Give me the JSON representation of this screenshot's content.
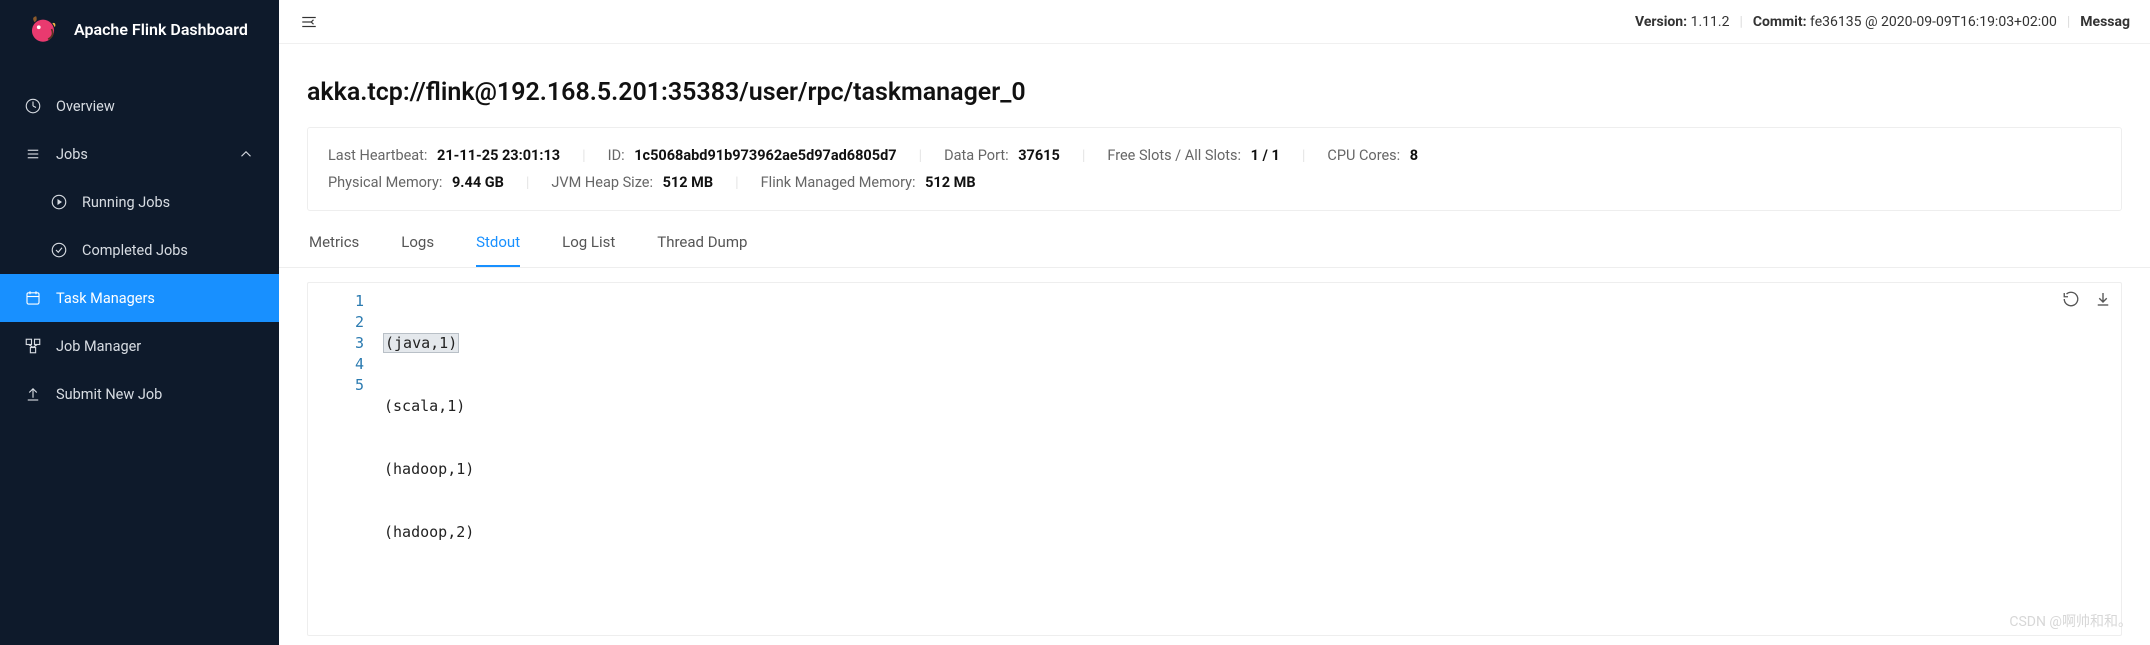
{
  "app": {
    "title": "Apache Flink Dashboard"
  },
  "sidebar": {
    "items": [
      {
        "id": "overview",
        "label": "Overview"
      },
      {
        "id": "jobs",
        "label": "Jobs"
      },
      {
        "id": "running",
        "label": "Running Jobs"
      },
      {
        "id": "completed",
        "label": "Completed Jobs"
      },
      {
        "id": "taskmanagers",
        "label": "Task Managers"
      },
      {
        "id": "jobmanager",
        "label": "Job Manager"
      },
      {
        "id": "submit",
        "label": "Submit New Job"
      }
    ]
  },
  "topbar": {
    "version_label": "Version:",
    "version_value": "1.11.2",
    "commit_label": "Commit:",
    "commit_value": "fe36135 @ 2020-09-09T16:19:03+02:00",
    "messages_label": "Messag"
  },
  "page": {
    "title": "akka.tcp://flink@192.168.5.201:35383/user/rpc/taskmanager_0"
  },
  "stats": {
    "heartbeat_label": "Last Heartbeat:",
    "heartbeat_value": "21-11-25 23:01:13",
    "id_label": "ID:",
    "id_value": "1c5068abd91b973962ae5d97ad6805d7",
    "dataport_label": "Data Port:",
    "dataport_value": "37615",
    "slots_label": "Free Slots / All Slots:",
    "slots_value": "1 / 1",
    "cpu_label": "CPU Cores:",
    "cpu_value": "8",
    "physmem_label": "Physical Memory:",
    "physmem_value": "9.44 GB",
    "heap_label": "JVM Heap Size:",
    "heap_value": "512 MB",
    "managed_label": "Flink Managed Memory:",
    "managed_value": "512 MB"
  },
  "tabs": {
    "metrics": "Metrics",
    "logs": "Logs",
    "stdout": "Stdout",
    "loglist": "Log List",
    "threaddump": "Thread Dump"
  },
  "stdout": {
    "line_numbers": [
      "1",
      "2",
      "3",
      "4",
      "5"
    ],
    "lines": [
      "(java,1)",
      "(scala,1)",
      "(hadoop,1)",
      "(hadoop,2)",
      ""
    ]
  },
  "watermark": "CSDN @啊帅和和。"
}
